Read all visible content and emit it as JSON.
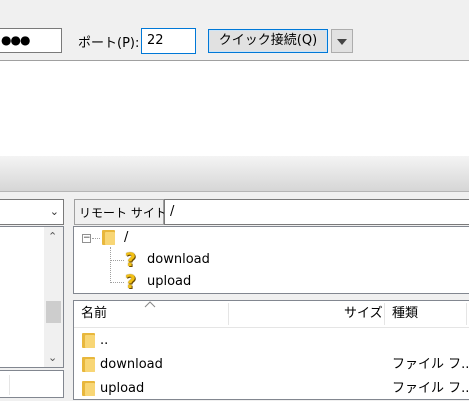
{
  "quick_connect": {
    "password_value": "●●●",
    "port_label": "ポート(P):",
    "port_value": "22",
    "connect_button_label": "クイック接続(Q)"
  },
  "local_pane": {
    "scroll_up_glyph": "⌃",
    "scroll_down_glyph": "⌄",
    "combo_chevron_glyph": "⌄"
  },
  "remote_pane": {
    "site_label": "リモート サイト:",
    "path_value": "/",
    "tree": {
      "root": {
        "label": "/",
        "expander": "−"
      },
      "children": [
        {
          "label": "download"
        },
        {
          "label": "upload"
        }
      ]
    },
    "list": {
      "columns": {
        "name": "名前",
        "size": "サイズ",
        "type": "種類"
      },
      "rows": [
        {
          "name": "..",
          "type": ""
        },
        {
          "name": "download",
          "type": "ファイル フ..."
        },
        {
          "name": "upload",
          "type": "ファイル フ..."
        }
      ]
    }
  },
  "colors": {
    "focus_blue": "#0078d7",
    "folder_yellow": "#f8d675",
    "question_yellow": "#f2c014"
  }
}
